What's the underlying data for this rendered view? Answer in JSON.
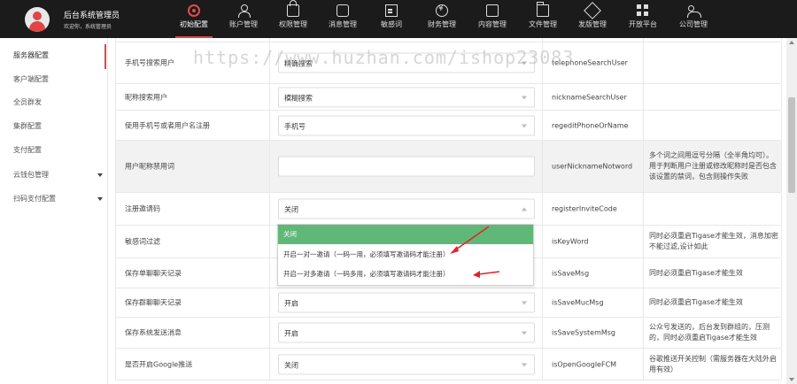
{
  "header": {
    "title": "后台系统管理员",
    "subtitle": "欢迎你，系统管理员",
    "nav": [
      {
        "label": "初始配置",
        "icon": "gear-icon",
        "active": true
      },
      {
        "label": "账户管理",
        "icon": "person-icon"
      },
      {
        "label": "权限管理",
        "icon": "lock-icon"
      },
      {
        "label": "消息管理",
        "icon": "chat-icon"
      },
      {
        "label": "敏感词",
        "icon": "document-icon"
      },
      {
        "label": "财务管理",
        "icon": "coin-icon"
      },
      {
        "label": "内容管理",
        "icon": "monitor-icon"
      },
      {
        "label": "文件管理",
        "icon": "folder-icon"
      },
      {
        "label": "发版管理",
        "icon": "send-icon"
      },
      {
        "label": "开放平台",
        "icon": "grid-icon"
      },
      {
        "label": "公司管理",
        "icon": "group-icon"
      }
    ]
  },
  "sidebar": {
    "items": [
      {
        "label": "服务器配置",
        "active": true
      },
      {
        "label": "客户端配置"
      },
      {
        "label": "全员群发"
      },
      {
        "label": "集群配置"
      },
      {
        "label": "支付配置"
      },
      {
        "label": "云钱包管理",
        "has_caret": true
      },
      {
        "label": "扫码支付配置",
        "has_caret": true
      }
    ]
  },
  "rows": [
    {
      "name": "手机号搜索用户",
      "value": "精确搜索",
      "key": "telephoneSearchUser",
      "note": "",
      "type": "select"
    },
    {
      "name": "昵称搜索用户",
      "value": "模糊搜索",
      "key": "nicknameSearchUser",
      "note": "",
      "type": "select"
    },
    {
      "name": "使用手机号或者用户名注册",
      "value": "手机号",
      "key": "regeditPhoneOrName",
      "note": "",
      "type": "select"
    },
    {
      "name": "用户昵称禁用词",
      "value": "",
      "key": "userNicknameNotword",
      "note": "多个词之间用逗号分隔（全半角均可）。用于判断用户注册或修改昵称时是否包含该设置的禁词，包含则操作失败",
      "type": "input"
    },
    {
      "name": "注册邀请码",
      "value": "关闭",
      "key": "registerInviteCode",
      "note": "",
      "type": "select-open"
    },
    {
      "name": "敏感词过滤",
      "value": "",
      "key": "isKeyWord",
      "note": "同时必须重启Tigase才能生效，消息加密不能过滤,设计如此",
      "type": "none"
    },
    {
      "name": "保存单聊聊天记录",
      "value": "",
      "key": "isSaveMsg",
      "note": "同时必须重启Tigase才能生效",
      "type": "none"
    },
    {
      "name": "保存群聊聊天记录",
      "value": "开启",
      "key": "isSaveMucMsg",
      "note": "同时必须重启Tigase才能生效",
      "type": "select"
    },
    {
      "name": "保存系统发送消息",
      "value": "开启",
      "key": "isSaveSystemMsg",
      "note": "公众号发送的，后台发到群组的，压测的，同时必须重启Tigase才能生效",
      "type": "select"
    },
    {
      "name": "是否开启Google推送",
      "value": "关闭",
      "key": "isOpenGoogleFCM",
      "note": "谷歌推送开关控制（需服务器在大陆外启用有效）",
      "type": "select"
    }
  ],
  "dropdown": {
    "options": [
      {
        "label": "关闭",
        "selected": true
      },
      {
        "label": "开启一对一邀请（一码一用，必须填写邀请码才能注册）"
      },
      {
        "label": "开启一对多邀请（一码多用，必须填写邀请码才能注册）"
      }
    ]
  },
  "watermark": "https://www.huzhan.com/ishop23083",
  "colors": {
    "topbar": "#1b1b1b",
    "accent": "#e04646",
    "selected_option": "#5fb878",
    "annotation_arrow": "#e0232e"
  }
}
